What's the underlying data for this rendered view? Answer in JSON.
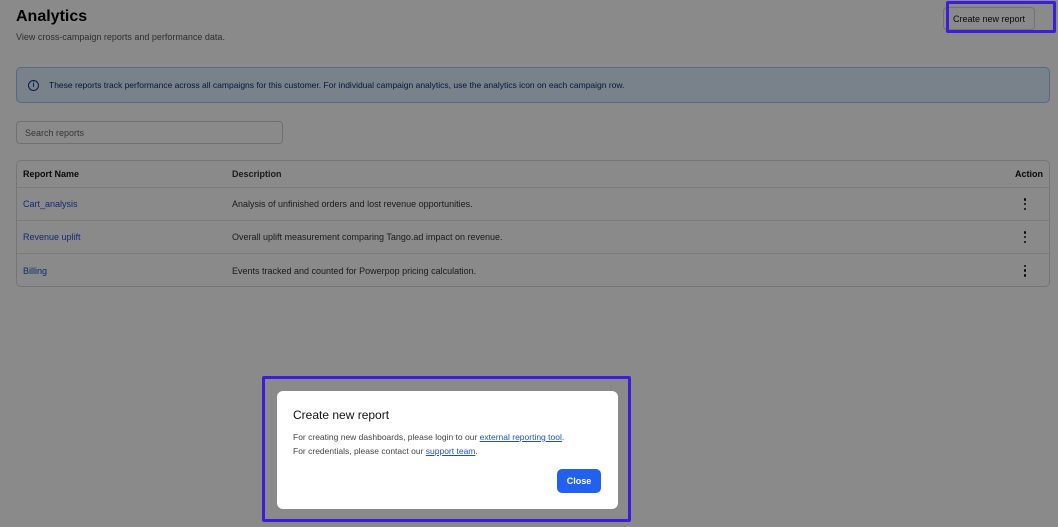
{
  "header": {
    "title": "Analytics",
    "subtitle": "View cross-campaign reports and performance data.",
    "create_button_label": "Create new report"
  },
  "banner": {
    "icon": "info-icon",
    "icon_glyph": "i",
    "text": "These reports track performance across all campaigns for this customer. For individual campaign analytics, use the analytics icon on each campaign row."
  },
  "search": {
    "placeholder": "Search reports",
    "value": ""
  },
  "table": {
    "columns": [
      "Report Name",
      "Description",
      "Action"
    ],
    "rows": [
      {
        "name": "Cart_analysis",
        "description": "Analysis of unfinished orders and lost revenue opportunities.",
        "action_icon": "more-vertical-icon"
      },
      {
        "name": "Revenue uplift",
        "description": "Overall uplift measurement comparing Tango.ad impact on revenue.",
        "action_icon": "more-vertical-icon"
      },
      {
        "name": "Billing",
        "description": "Events tracked and counted for Powerpop pricing calculation.",
        "action_icon": "more-vertical-icon"
      }
    ]
  },
  "modal": {
    "title": "Create new report",
    "line1_prefix": "For creating new dashboards, please login to our ",
    "line1_link": "external reporting tool",
    "line1_suffix": ".",
    "line2_prefix": "For credentials, please contact our ",
    "line2_link": "support team",
    "line2_suffix": ".",
    "close_label": "Close"
  },
  "colors": {
    "highlight": "#3a1fd6",
    "primary_button": "#2161ee",
    "link": "#1d4fd6",
    "banner_bg": "#dfeeff"
  }
}
